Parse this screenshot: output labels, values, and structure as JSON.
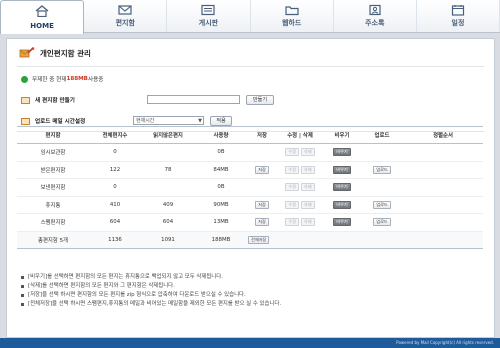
{
  "nav": {
    "tabs": [
      {
        "label": "HOME",
        "icon": "home-icon"
      },
      {
        "label": "편지함",
        "icon": "envelope-icon"
      },
      {
        "label": "게시판",
        "icon": "board-icon"
      },
      {
        "label": "웹하드",
        "icon": "folder-icon"
      },
      {
        "label": "주소록",
        "icon": "address-book-icon"
      },
      {
        "label": "일정",
        "icon": "calendar-icon"
      }
    ]
  },
  "page": {
    "title": "개인편지함 관리",
    "usage_prefix": "무제한 중 현재 ",
    "usage_value": "188MB",
    "usage_suffix": " 사용중",
    "new_mailbox_label": "새 편지함 만들기",
    "create_button": "만들기",
    "upload_time_label": "업로드 메일 시간설정",
    "upload_time_select": "현재시간",
    "apply_button": "적용"
  },
  "table": {
    "headers": [
      "편지함",
      "전체편지수",
      "읽지않은편지",
      "사용량",
      "저장",
      "수정 | 삭제",
      "비우기",
      "업로드",
      "정렬순서"
    ],
    "rows": [
      {
        "name": "임시보관함",
        "total": "0",
        "unread": "",
        "size": "0B",
        "save": false,
        "edit_enabled": false,
        "empty": true,
        "upload": false
      },
      {
        "name": "받은편지함",
        "total": "122",
        "unread": "78",
        "size": "84MB",
        "save": true,
        "edit_enabled": false,
        "empty": true,
        "upload": true
      },
      {
        "name": "보낸편지함",
        "total": "0",
        "unread": "",
        "size": "0B",
        "save": false,
        "edit_enabled": false,
        "empty": true,
        "upload": false
      },
      {
        "name": "휴지통",
        "total": "410",
        "unread": "409",
        "size": "90MB",
        "save": true,
        "edit_enabled": false,
        "empty": true,
        "upload": true
      },
      {
        "name": "스팸편지함",
        "total": "604",
        "unread": "604",
        "size": "13MB",
        "save": true,
        "edit_enabled": false,
        "empty": true,
        "upload": true
      }
    ],
    "total_row": {
      "name": "총편지함 5개",
      "total": "1136",
      "unread": "1091",
      "size": "188MB",
      "save_all": "전체저장"
    },
    "button_labels": {
      "save": "저장",
      "edit": "수정",
      "delete": "삭제",
      "empty": "비우기",
      "upload": "업로드"
    }
  },
  "notes": [
    "[비우기]를 선택하면 편지함의 모든 편지는 휴지통으로 백업되지 않고 모두 삭제됩니다.",
    "[삭제]를 선택하면 편지함의 모든 편지와 그 편지함은 삭제됩니다.",
    "[저장]을 선택 하시면 편지함의 모든 편지를 zip 형식으로 압축하여 다운로드 받으실 수 있습니다.",
    "[전체저장]을 선택 하시면 스팸편지,휴지통의 메일과 비어있는 메일함을 제외한 모든 편지를 받으 실 수 있습니다."
  ],
  "footer": "Powered by Mail Copyright(c) All rights reserved."
}
